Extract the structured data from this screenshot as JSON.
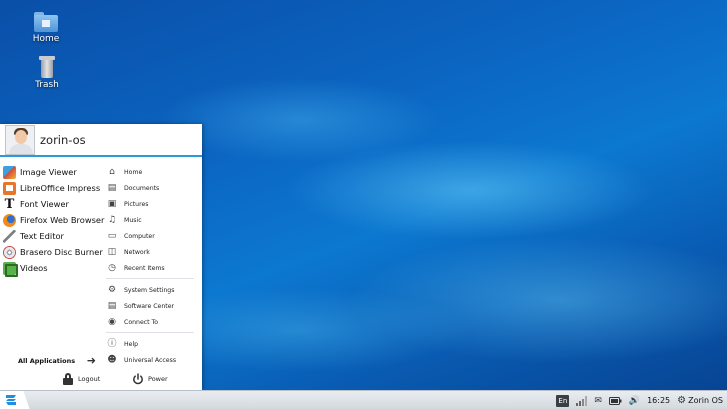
{
  "desktop": {
    "icons": [
      {
        "label": "Home",
        "icon": "home-folder-icon"
      },
      {
        "label": "Trash",
        "icon": "trash-icon"
      }
    ]
  },
  "menu": {
    "username": "zorin-os",
    "apps": [
      {
        "label": "Image Viewer",
        "icon": "image-viewer-icon"
      },
      {
        "label": "LibreOffice Impress",
        "icon": "libreoffice-impress-icon"
      },
      {
        "label": "Font Viewer",
        "icon": "font-viewer-icon"
      },
      {
        "label": "Firefox Web Browser",
        "icon": "firefox-icon"
      },
      {
        "label": "Text Editor",
        "icon": "text-editor-icon"
      },
      {
        "label": "Brasero Disc Burner",
        "icon": "brasero-icon"
      },
      {
        "label": "Videos",
        "icon": "videos-icon"
      }
    ],
    "all_apps_label": "All Applications",
    "places": [
      {
        "label": "Home",
        "icon": "home-icon"
      },
      {
        "label": "Documents",
        "icon": "documents-icon"
      },
      {
        "label": "Pictures",
        "icon": "pictures-icon"
      },
      {
        "label": "Music",
        "icon": "music-icon"
      },
      {
        "label": "Computer",
        "icon": "computer-icon"
      },
      {
        "label": "Network",
        "icon": "network-icon"
      },
      {
        "label": "Recent Items",
        "icon": "recent-icon"
      }
    ],
    "system": [
      {
        "label": "System Settings",
        "icon": "settings-icon"
      },
      {
        "label": "Software Center",
        "icon": "software-center-icon"
      },
      {
        "label": "Connect To",
        "icon": "connect-icon"
      }
    ],
    "help": [
      {
        "label": "Help",
        "icon": "help-icon"
      },
      {
        "label": "Universal Access",
        "icon": "universal-access-icon"
      }
    ],
    "logout_label": "Logout",
    "power_label": "Power"
  },
  "taskbar": {
    "keyboard_layout": "En",
    "clock": "16:25",
    "os_label": "Zorin OS"
  }
}
